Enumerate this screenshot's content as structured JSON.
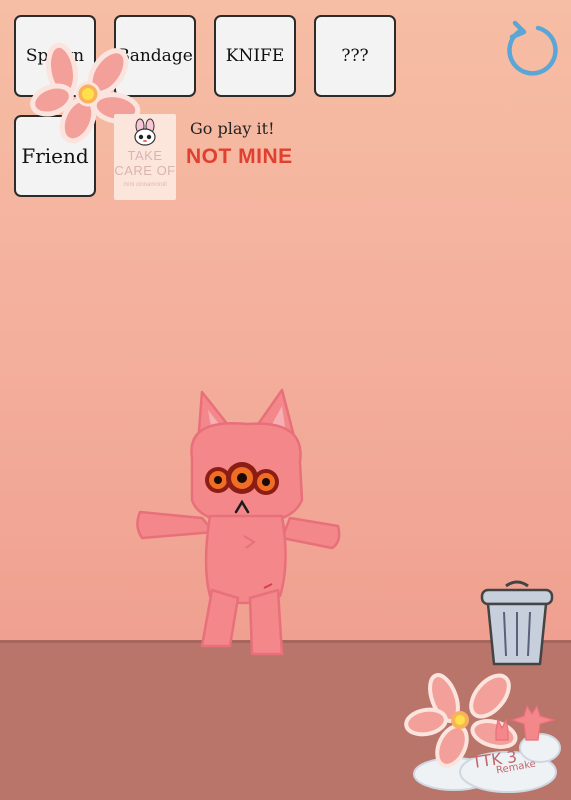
{
  "toolbar": {
    "spawn_label": "Spawn",
    "bandage_label": "Bandage",
    "knife_label": "KNIFE",
    "unknown_label": "???",
    "friend_label": "Friend"
  },
  "promo": {
    "thumbnail_line1": "TAKE",
    "thumbnail_line2": "CARE OF",
    "thumbnail_line3": "mini cinnamoroll",
    "cta": "Go play it!",
    "note": "NOT MINE"
  },
  "logo": {
    "text": "TTK 3",
    "subtext": "Remake"
  },
  "icons": {
    "reset": "reset-arrow-icon",
    "trash": "trash-can-icon",
    "flower": "flower-icon"
  },
  "colors": {
    "background_top": "#f6bea4",
    "background_bottom": "#f0a090",
    "floor": "#b9756a",
    "creature": "#f3878a",
    "note_red": "#e0402f",
    "reset_blue": "#5aa6d6"
  }
}
